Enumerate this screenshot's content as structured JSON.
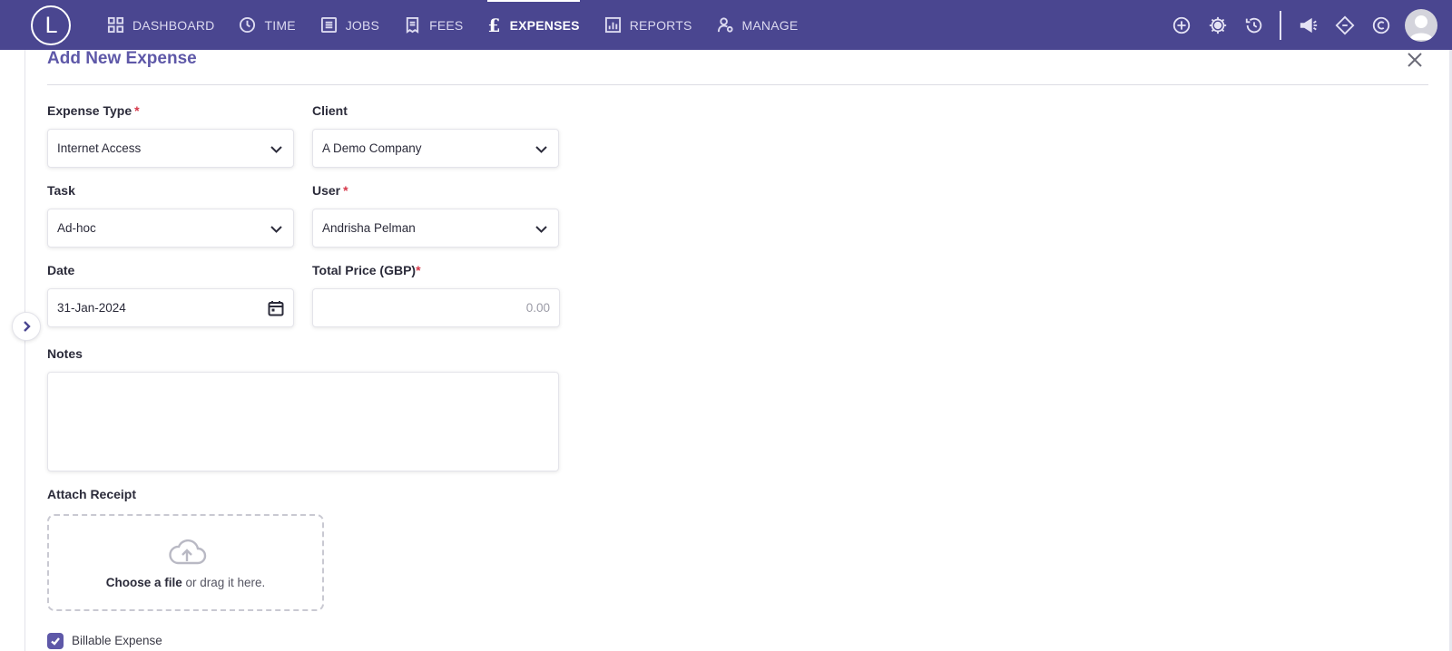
{
  "logo": {
    "letter": "L"
  },
  "nav": {
    "items": [
      {
        "label": "DASHBOARD",
        "icon": "grid-icon"
      },
      {
        "label": "TIME",
        "icon": "clock-icon"
      },
      {
        "label": "JOBS",
        "icon": "list-icon"
      },
      {
        "label": "FEES",
        "icon": "receipt-icon"
      },
      {
        "label": "EXPENSES",
        "icon": "pound-icon",
        "active": true
      },
      {
        "label": "REPORTS",
        "icon": "bar-chart-icon"
      },
      {
        "label": "MANAGE",
        "icon": "user-gear-icon"
      }
    ]
  },
  "toolbar": {
    "icons": [
      "plus-circle-icon",
      "gear-icon",
      "history-icon",
      "megaphone-icon",
      "diamond-icon",
      "c-badge-icon",
      "avatar-icon"
    ]
  },
  "form": {
    "title": "Add New Expense",
    "expense_type": {
      "label": "Expense Type",
      "required_mark": "*",
      "value": "Internet Access"
    },
    "client": {
      "label": "Client",
      "value": "A Demo Company"
    },
    "task": {
      "label": "Task",
      "value": "Ad-hoc"
    },
    "user": {
      "label": "User",
      "required_mark": "*",
      "value": "Andrisha Pelman"
    },
    "date": {
      "label": "Date",
      "value": "31-Jan-2024"
    },
    "total_price": {
      "label": "Total Price (GBP)",
      "required_mark": "*",
      "placeholder": "0.00"
    },
    "notes": {
      "label": "Notes",
      "value": ""
    },
    "attach": {
      "label": "Attach Receipt",
      "choose": "Choose a file",
      "drag": " or drag it here."
    },
    "billable": {
      "label": "Billable Expense",
      "checked": true
    }
  },
  "colors": {
    "topbar": "#4a4690",
    "accent": "#5e58a8",
    "required": "#d6384a"
  }
}
